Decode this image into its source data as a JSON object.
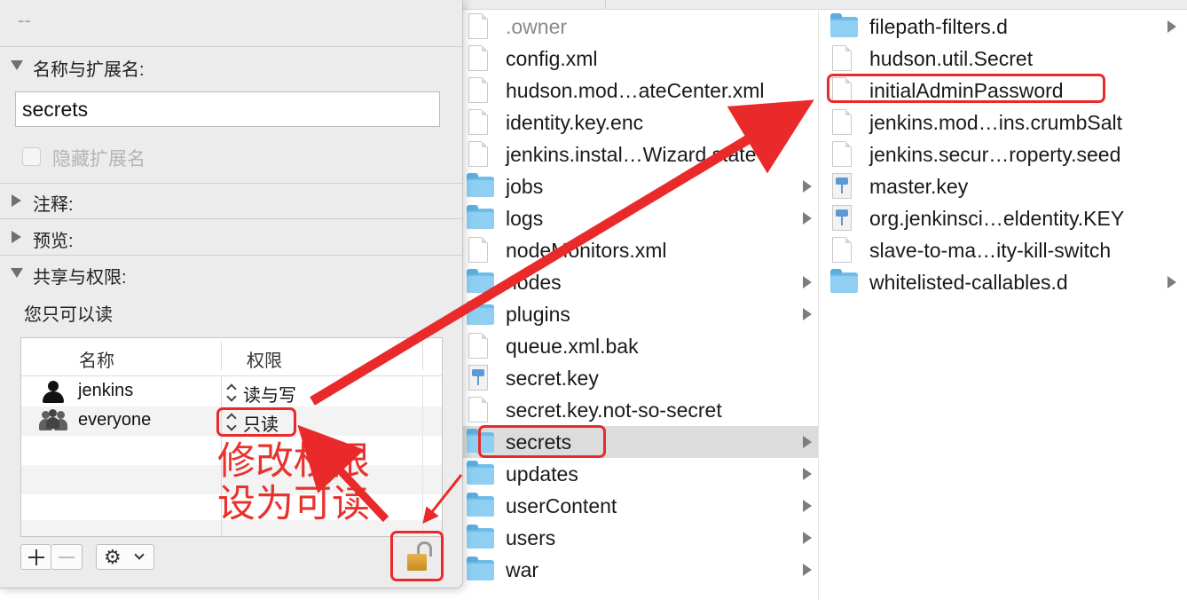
{
  "panel": {
    "title_placeholder": "--",
    "sections": {
      "name_ext": "名称与扩展名:",
      "comments": "注释:",
      "preview": "预览:",
      "sharing": "共享与权限:"
    },
    "name_value": "secrets",
    "hide_extension_label": "隐藏扩展名",
    "permission_note": "您只可以读",
    "table": {
      "headers": [
        "名称",
        "权限"
      ],
      "rows": [
        {
          "name": "jenkins",
          "privilege": "读与写",
          "icon": "user-icon"
        },
        {
          "name": "everyone",
          "privilege": "只读",
          "icon": "group-icon"
        }
      ]
    }
  },
  "finder": {
    "column1": [
      {
        "name": ".owner",
        "type": "doc",
        "dim": true
      },
      {
        "name": "config.xml",
        "type": "doc"
      },
      {
        "name": "hudson.mod…ateCenter.xml",
        "type": "doc"
      },
      {
        "name": "identity.key.enc",
        "type": "doc"
      },
      {
        "name": "jenkins.instal…Wizard.state",
        "type": "doc"
      },
      {
        "name": "jobs",
        "type": "folder"
      },
      {
        "name": "logs",
        "type": "folder"
      },
      {
        "name": "nodeMonitors.xml",
        "type": "doc"
      },
      {
        "name": "nodes",
        "type": "folder"
      },
      {
        "name": "plugins",
        "type": "folder"
      },
      {
        "name": "queue.xml.bak",
        "type": "doc"
      },
      {
        "name": "secret.key",
        "type": "key"
      },
      {
        "name": "secret.key.not-so-secret",
        "type": "doc"
      },
      {
        "name": "secrets",
        "type": "folder",
        "selected": true
      },
      {
        "name": "updates",
        "type": "folder"
      },
      {
        "name": "userContent",
        "type": "folder"
      },
      {
        "name": "users",
        "type": "folder"
      },
      {
        "name": "war",
        "type": "folder"
      }
    ],
    "column2": [
      {
        "name": "filepath-filters.d",
        "type": "folder"
      },
      {
        "name": "hudson.util.Secret",
        "type": "doc"
      },
      {
        "name": "initialAdminPassword",
        "type": "doc"
      },
      {
        "name": "jenkins.mod…ins.crumbSalt",
        "type": "doc"
      },
      {
        "name": "jenkins.secur…roperty.seed",
        "type": "doc"
      },
      {
        "name": "master.key",
        "type": "key"
      },
      {
        "name": "org.jenkinsci…eldentity.KEY",
        "type": "key"
      },
      {
        "name": "slave-to-ma…ity-kill-switch",
        "type": "doc"
      },
      {
        "name": "whitelisted-callables.d",
        "type": "folder"
      }
    ]
  },
  "annotation": {
    "line1": "修改权限",
    "line2": "设为可读",
    "color": "#e8332d"
  }
}
